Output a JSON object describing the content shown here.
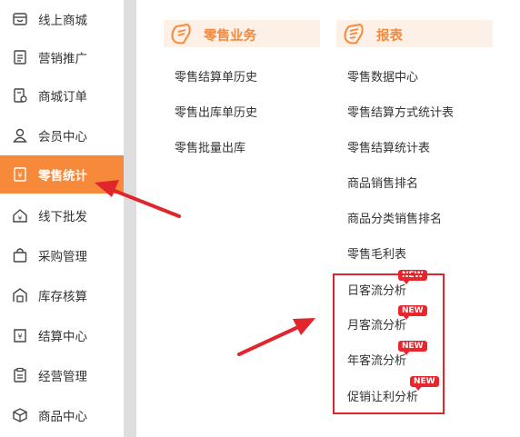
{
  "sidebar": {
    "items": [
      {
        "label": "线上商城",
        "icon": "store-icon"
      },
      {
        "label": "营销推广",
        "icon": "megaphone-doc-icon"
      },
      {
        "label": "商城订单",
        "icon": "order-icon"
      },
      {
        "label": "会员中心",
        "icon": "member-icon"
      },
      {
        "label": "零售统计",
        "icon": "retail-stats-icon",
        "active": true
      },
      {
        "label": "线下批发",
        "icon": "wholesale-icon"
      },
      {
        "label": "采购管理",
        "icon": "shopping-bag-icon"
      },
      {
        "label": "库存核算",
        "icon": "warehouse-icon"
      },
      {
        "label": "结算中心",
        "icon": "yen-settlement-icon"
      },
      {
        "label": "经营管理",
        "icon": "clipboard-icon"
      },
      {
        "label": "商品中心",
        "icon": "cube-icon"
      }
    ]
  },
  "retail_business": {
    "title": "零售业务",
    "items": [
      "零售结算单历史",
      "零售出库单历史",
      "零售批量出库"
    ]
  },
  "reports": {
    "title": "报表",
    "items": [
      {
        "label": "零售数据中心"
      },
      {
        "label": "零售结算方式统计表"
      },
      {
        "label": "零售结算统计表"
      },
      {
        "label": "商品销售排名"
      },
      {
        "label": "商品分类销售排名"
      },
      {
        "label": "零售毛利表"
      },
      {
        "label": "日客流分析",
        "badge": "NEW"
      },
      {
        "label": "月客流分析",
        "badge": "NEW"
      },
      {
        "label": "年客流分析",
        "badge": "NEW"
      },
      {
        "label": "促销让利分析",
        "badge": "NEW"
      }
    ]
  },
  "colors": {
    "accent": "#f7893b",
    "header_bg": "#fdf0e6",
    "badge": "#e8262c",
    "annotation": "#e0262c"
  }
}
